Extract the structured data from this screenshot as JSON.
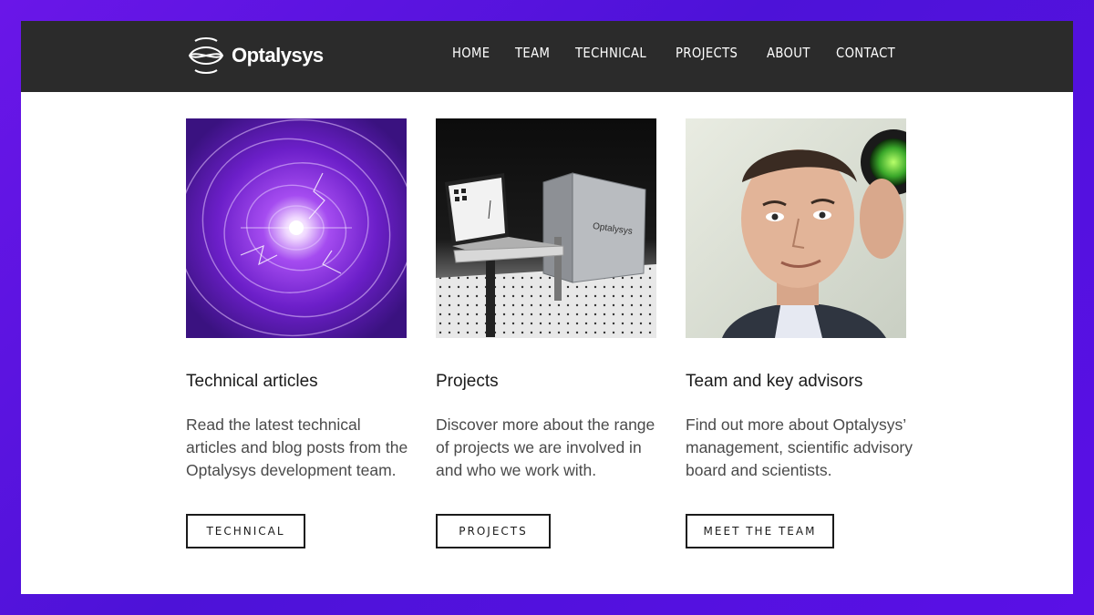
{
  "brand": {
    "name": "Optalysys",
    "logo_icon": "optalysys-logo-icon"
  },
  "nav": {
    "items": [
      "HOME",
      "TEAM",
      "TECHNICAL",
      "PROJECTS",
      "ABOUT",
      "CONTACT"
    ]
  },
  "cards": [
    {
      "image": "purple-light-vortex-image",
      "title": "Technical articles",
      "text": "Read the latest technical articles and blog posts from the Optalysys development team.",
      "button": "TECHNICAL"
    },
    {
      "image": "optical-computer-laptop-case-image",
      "title": "Projects",
      "text": "Discover more about the range of projects we are involved in and who we work with.",
      "button": "PROJECTS"
    },
    {
      "image": "team-member-portrait-image",
      "title": "Team and key advisors",
      "text": "Find out more about Optalysys’ management, scientific advisory board and scientists.",
      "button": "MEET THE TEAM"
    }
  ],
  "colors": {
    "background": "#5a10e6",
    "navbar": "#2b2b2b",
    "text": "#1b1b1b"
  }
}
